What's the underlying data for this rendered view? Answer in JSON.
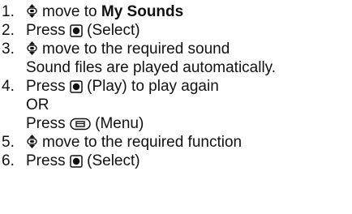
{
  "steps": [
    {
      "num": "1.",
      "text": "move to",
      "bold": "My Sounds"
    },
    {
      "num": "2.",
      "press": "Press",
      "label": "(Select)"
    },
    {
      "num": "3.",
      "text": "move to the required sound",
      "note": "Sound files are played automatically."
    },
    {
      "num": "4.",
      "press": "Press",
      "label": "(Play) to play again",
      "or": "OR",
      "press2": "Press",
      "label2": "(Menu)"
    },
    {
      "num": "5.",
      "text": "move to the required function"
    },
    {
      "num": "6.",
      "press": "Press",
      "label": "(Select)"
    }
  ],
  "icons": {
    "navigate": "navigation-key-icon",
    "select": "center-select-key-icon",
    "menu": "menu-key-icon"
  }
}
